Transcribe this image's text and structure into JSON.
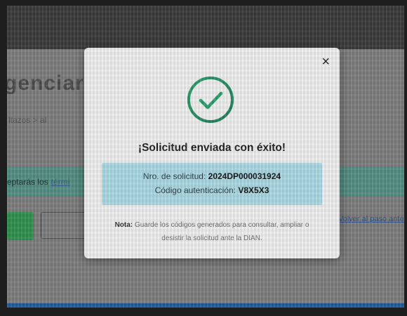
{
  "background": {
    "title": "genciar s",
    "breadcrumb": "ltazos  >  al",
    "accept_text": "eptarás los",
    "accept_link": "térmi",
    "back_link": "Volver al paso anterior"
  },
  "modal": {
    "close_glyph": "×",
    "title": "¡Solicitud enviada con éxito!",
    "request_label": "Nro. de solicitud:",
    "request_number": "2024DP000031924",
    "auth_label": "Código autenticación:",
    "auth_code": "V8X5X3",
    "note_label": "Nota:",
    "note_text": "Guarde los códigos generados para consultar, ampliar o desistir la solicitud ante la DIAN.",
    "icon": "check-circle-icon"
  },
  "colors": {
    "success_green": "#2e8b57",
    "info_box": "#a9d7e2",
    "accent_bar": "#1e5c9c"
  }
}
